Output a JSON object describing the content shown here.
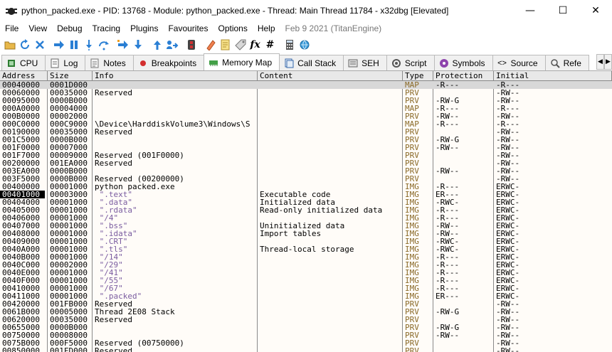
{
  "window": {
    "title": "python_packed.exe - PID: 13768 - Module: python_packed.exe - Thread: Main Thread 11784 - x32dbg [Elevated]",
    "minimize": "—",
    "maximize": "☐",
    "close": "✕"
  },
  "menu": {
    "items": [
      "File",
      "View",
      "Debug",
      "Tracing",
      "Plugins",
      "Favourites",
      "Options",
      "Help"
    ],
    "build": "Feb 9 2021 (TitanEngine)"
  },
  "toolbar": {
    "icons": [
      "open-icon",
      "restart-icon",
      "close-icon",
      "run-icon",
      "pause-icon",
      "step-into-icon",
      "step-over-icon",
      "trace-into-icon",
      "trace-over-icon",
      "run-to-user-icon",
      "execute-till-return-icon",
      "patch-icon",
      "bookmark-icon",
      "comment-icon",
      "label-icon",
      "function-icon",
      "hash-icon",
      "calculator-icon",
      "globe-icon"
    ]
  },
  "tabs": [
    {
      "label": "CPU",
      "icon": "cpu-icon"
    },
    {
      "label": "Log",
      "icon": "log-icon"
    },
    {
      "label": "Notes",
      "icon": "notes-icon"
    },
    {
      "label": "Breakpoints",
      "icon": "breakpoint-icon"
    },
    {
      "label": "Memory Map",
      "icon": "memory-map-icon",
      "active": true
    },
    {
      "label": "Call Stack",
      "icon": "call-stack-icon"
    },
    {
      "label": "SEH",
      "icon": "seh-icon"
    },
    {
      "label": "Script",
      "icon": "script-icon"
    },
    {
      "label": "Symbols",
      "icon": "symbols-icon"
    },
    {
      "label": "Source",
      "icon": "source-icon"
    },
    {
      "label": "Refe",
      "icon": "references-icon"
    }
  ],
  "columns": [
    "Address",
    "Size",
    "Info",
    "Content",
    "Type",
    "Protection",
    "Initial"
  ],
  "rows": [
    [
      "00040000",
      "0001D000",
      "",
      "",
      "MAP",
      "-R---",
      "-R---",
      "sel"
    ],
    [
      "00060000",
      "00035000",
      "Reserved",
      "",
      "PRV",
      "",
      "-RW--",
      ""
    ],
    [
      "00095000",
      "0000B000",
      "",
      "",
      "PRV",
      "-RW-G",
      "-RW--",
      ""
    ],
    [
      "000A0000",
      "00004000",
      "",
      "",
      "MAP",
      "-R---",
      "-R---",
      ""
    ],
    [
      "000B0000",
      "00002000",
      "",
      "",
      "PRV",
      "-RW--",
      "-RW--",
      ""
    ],
    [
      "000C0000",
      "000C9000",
      "\\Device\\HarddiskVolume3\\Windows\\S",
      "",
      "MAP",
      "-R---",
      "-R---",
      ""
    ],
    [
      "00190000",
      "00035000",
      "Reserved",
      "",
      "PRV",
      "",
      "-RW--",
      ""
    ],
    [
      "001C5000",
      "0000B000",
      "",
      "",
      "PRV",
      "-RW-G",
      "-RW--",
      ""
    ],
    [
      "001F0000",
      "00007000",
      "",
      "",
      "PRV",
      "-RW--",
      "-RW--",
      ""
    ],
    [
      "001F7000",
      "00009000",
      "Reserved (001F0000)",
      "",
      "PRV",
      "",
      "-RW--",
      ""
    ],
    [
      "00200000",
      "001EA000",
      "Reserved",
      "",
      "PRV",
      "",
      "-RW--",
      ""
    ],
    [
      "003EA000",
      "0000B000",
      "",
      "",
      "PRV",
      "-RW--",
      "-RW--",
      ""
    ],
    [
      "003F5000",
      "0000B000",
      "Reserved (00200000)",
      "",
      "PRV",
      "",
      "-RW--",
      ""
    ],
    [
      "00400000",
      "00001000",
      "python_packed.exe",
      "",
      "IMG",
      "-R---",
      "ERWC-",
      ""
    ],
    [
      "00401000",
      "00003000",
      " \".text\"",
      "Executable code",
      "IMG",
      "ER---",
      "ERWC-",
      "hl"
    ],
    [
      "00404000",
      "00001000",
      " \".data\"",
      "Initialized data",
      "IMG",
      "-RWC-",
      "ERWC-",
      ""
    ],
    [
      "00405000",
      "00001000",
      " \".rdata\"",
      "Read-only initialized data",
      "IMG",
      "-R---",
      "ERWC-",
      ""
    ],
    [
      "00406000",
      "00001000",
      " \"/4\"",
      "",
      "IMG",
      "-R---",
      "ERWC-",
      ""
    ],
    [
      "00407000",
      "00001000",
      " \".bss\"",
      "Uninitialized data",
      "IMG",
      "-RW--",
      "ERWC-",
      ""
    ],
    [
      "00408000",
      "00001000",
      " \".idata\"",
      "Import tables",
      "IMG",
      "-RW--",
      "ERWC-",
      ""
    ],
    [
      "00409000",
      "00001000",
      " \".CRT\"",
      "",
      "IMG",
      "-RWC-",
      "ERWC-",
      ""
    ],
    [
      "0040A000",
      "00001000",
      " \".tls\"",
      "Thread-local storage",
      "IMG",
      "-RWC-",
      "ERWC-",
      ""
    ],
    [
      "0040B000",
      "00001000",
      " \"/14\"",
      "",
      "IMG",
      "-R---",
      "ERWC-",
      ""
    ],
    [
      "0040C000",
      "00002000",
      " \"/29\"",
      "",
      "IMG",
      "-R---",
      "ERWC-",
      ""
    ],
    [
      "0040E000",
      "00001000",
      " \"/41\"",
      "",
      "IMG",
      "-R---",
      "ERWC-",
      ""
    ],
    [
      "0040F000",
      "00001000",
      " \"/55\"",
      "",
      "IMG",
      "-R---",
      "ERWC-",
      ""
    ],
    [
      "00410000",
      "00001000",
      " \"/67\"",
      "",
      "IMG",
      "-R---",
      "ERWC-",
      ""
    ],
    [
      "00411000",
      "00001000",
      " \".packed\"",
      "",
      "IMG",
      "ER---",
      "ERWC-",
      ""
    ],
    [
      "00420000",
      "001FB000",
      "Reserved",
      "",
      "PRV",
      "",
      "-RW--",
      ""
    ],
    [
      "0061B000",
      "00005000",
      "Thread 2E08 Stack",
      "",
      "PRV",
      "-RW-G",
      "-RW--",
      ""
    ],
    [
      "00620000",
      "00035000",
      "Reserved",
      "",
      "PRV",
      "",
      "-RW--",
      ""
    ],
    [
      "00655000",
      "0000B000",
      "",
      "",
      "PRV",
      "-RW-G",
      "-RW--",
      ""
    ],
    [
      "00750000",
      "00008000",
      "",
      "",
      "PRV",
      "-RW--",
      "-RW--",
      ""
    ],
    [
      "0075B000",
      "000F5000",
      "Reserved (00750000)",
      "",
      "PRV",
      "",
      "-RW--",
      ""
    ],
    [
      "00850000",
      "001FD000",
      "Reserved",
      "",
      "PRV",
      "",
      "-RW--",
      ""
    ]
  ],
  "colors": {
    "type_text": "#8b6b2a",
    "section_name": "#7a5ca0",
    "grid_bg": "#fffcf8",
    "header_bg": "#e8e8e8",
    "selected_row": "#d8d8d8"
  }
}
